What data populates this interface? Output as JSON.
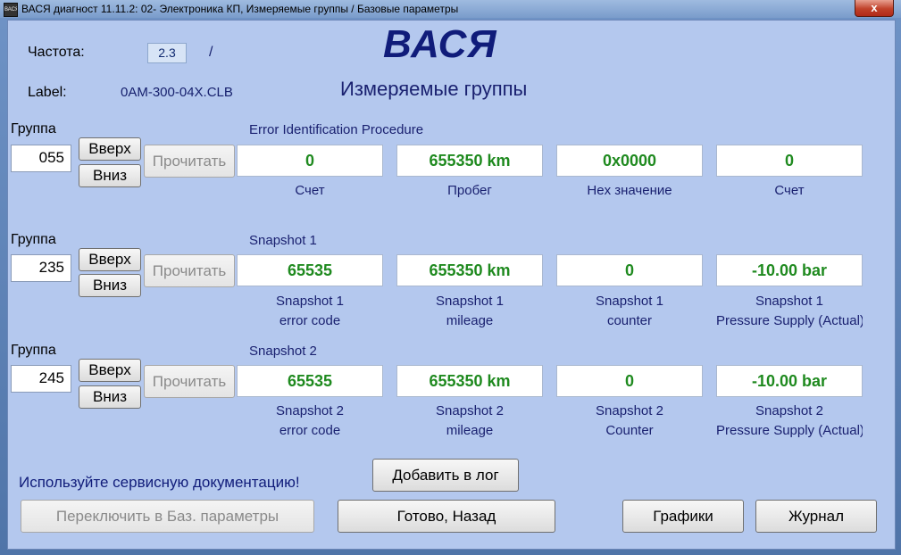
{
  "window": {
    "title": "ВАСЯ диагност 11.11.2: 02- Электроника КП,  Измеряемые группы / Базовые параметры",
    "app_icon_text": "ВАСЯ",
    "close_label": "x"
  },
  "header": {
    "freq_label": "Частота:",
    "freq_value": "2.3",
    "freq_sep": "/",
    "label_label": "Label:",
    "label_value": "0AM-300-04X.CLB",
    "brand": "ВАСЯ",
    "subtitle": "Измеряемые группы"
  },
  "groups": [
    {
      "label": "Группа",
      "number": "055",
      "up": "Вверх",
      "down": "Вниз",
      "read": "Прочитать",
      "title": "Error Identification Procedure",
      "fields": [
        {
          "value": "0",
          "cap1": "Счет",
          "cap2": ""
        },
        {
          "value": "655350 km",
          "cap1": "Пробег",
          "cap2": ""
        },
        {
          "value": "0x0000",
          "cap1": "Hex значение",
          "cap2": ""
        },
        {
          "value": "0",
          "cap1": "Счет",
          "cap2": ""
        }
      ]
    },
    {
      "label": "Группа",
      "number": "235",
      "up": "Вверх",
      "down": "Вниз",
      "read": "Прочитать",
      "title": "Snapshot 1",
      "fields": [
        {
          "value": "65535",
          "cap1": "Snapshot 1",
          "cap2": "error code"
        },
        {
          "value": "655350 km",
          "cap1": "Snapshot 1",
          "cap2": "mileage"
        },
        {
          "value": "0",
          "cap1": "Snapshot 1",
          "cap2": "counter"
        },
        {
          "value": "-10.00 bar",
          "cap1": "Snapshot 1",
          "cap2": "Pressure Supply (Actual)"
        }
      ]
    },
    {
      "label": "Группа",
      "number": "245",
      "up": "Вверх",
      "down": "Вниз",
      "read": "Прочитать",
      "title": "Snapshot 2",
      "fields": [
        {
          "value": "65535",
          "cap1": "Snapshot 2",
          "cap2": "error code"
        },
        {
          "value": "655350 km",
          "cap1": "Snapshot 2",
          "cap2": "mileage"
        },
        {
          "value": "0",
          "cap1": "Snapshot 2",
          "cap2": "Counter"
        },
        {
          "value": "-10.00 bar",
          "cap1": "Snapshot 2",
          "cap2": "Pressure Supply (Actual)"
        }
      ]
    }
  ],
  "footer": {
    "note": "Используйте сервисную документацию!",
    "add_log": "Добавить в лог",
    "switch_basic": "Переключить в Баз. параметры",
    "done_back": "Готово, Назад",
    "graphs": "Графики",
    "journal": "Журнал"
  },
  "colors": {
    "value_text": "#1f8a1f",
    "panel_bg": "#b4c8ee",
    "brand": "#101c7a"
  }
}
